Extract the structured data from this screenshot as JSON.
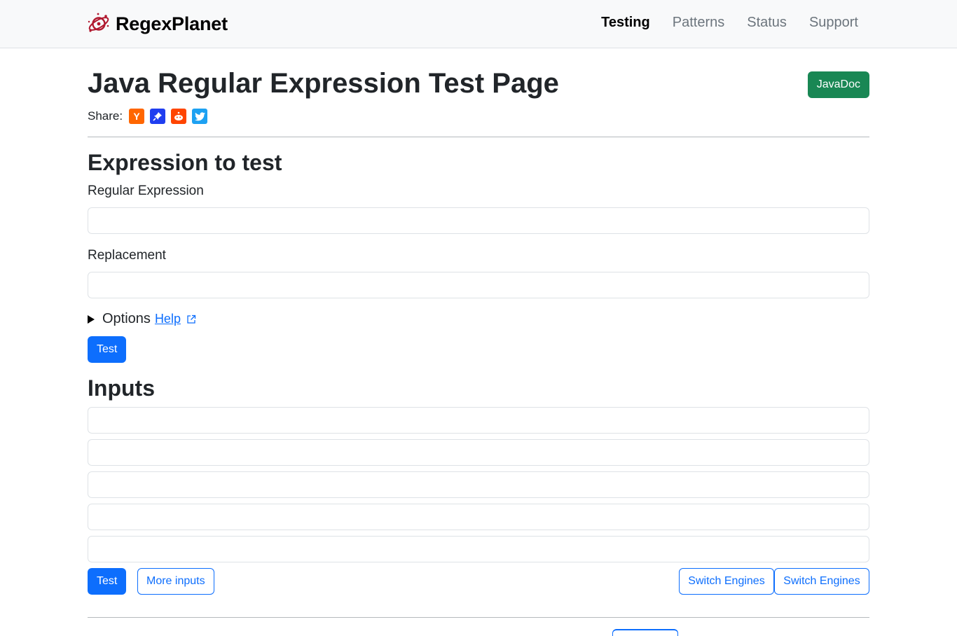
{
  "navbar": {
    "brand": "RegexPlanet",
    "links": [
      {
        "label": "Testing",
        "active": true
      },
      {
        "label": "Patterns",
        "active": false
      },
      {
        "label": "Status",
        "active": false
      },
      {
        "label": "Support",
        "active": false
      }
    ]
  },
  "header": {
    "title": "Java Regular Expression Test Page",
    "javadoc_button": "JavaDoc",
    "share_label": "Share:",
    "share_icons": [
      {
        "name": "hackernews-icon",
        "glyph": "Y",
        "color": "#ff6600"
      },
      {
        "name": "pinboard-icon",
        "glyph": "📌",
        "color": "#0000ff"
      },
      {
        "name": "reddit-icon",
        "glyph": "●",
        "color": "#ff4500"
      },
      {
        "name": "twitter-icon",
        "glyph": "🐦",
        "color": "#1da1f2"
      }
    ]
  },
  "expression": {
    "section_title": "Expression to test",
    "regex_label": "Regular Expression",
    "regex_value": "",
    "replacement_label": "Replacement",
    "replacement_value": "",
    "options_label": "Options",
    "help_label": "Help",
    "test_button": "Test"
  },
  "inputs": {
    "section_title": "Inputs",
    "values": [
      "",
      "",
      "",
      "",
      ""
    ],
    "test_button": "Test",
    "more_inputs_button": "More inputs",
    "switch_engines_buttons": [
      "Switch Engines",
      "Switch Engines"
    ]
  },
  "colors": {
    "primary": "#0d6efd",
    "success": "#198754",
    "navbar_bg": "#f8f9fa"
  }
}
